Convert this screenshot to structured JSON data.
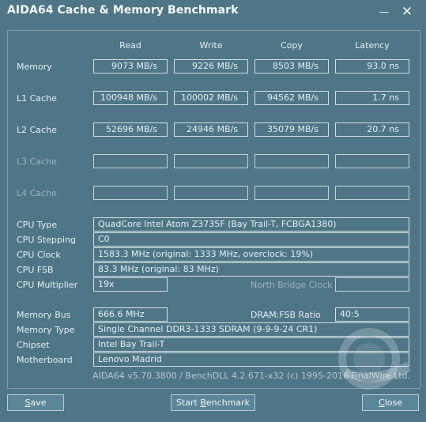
{
  "window": {
    "title": "AIDA64 Cache & Memory Benchmark",
    "minimize_glyph": "—",
    "close_glyph": "✕"
  },
  "columns": [
    "Read",
    "Write",
    "Copy",
    "Latency"
  ],
  "rows": [
    {
      "label": "Memory",
      "read": "9073 MB/s",
      "write": "9226 MB/s",
      "copy": "8503 MB/s",
      "latency": "93.0 ns",
      "enabled": true
    },
    {
      "label": "L1 Cache",
      "read": "100948 MB/s",
      "write": "100002 MB/s",
      "copy": "94562 MB/s",
      "latency": "1.7 ns",
      "enabled": true
    },
    {
      "label": "L2 Cache",
      "read": "52696 MB/s",
      "write": "24946 MB/s",
      "copy": "35079 MB/s",
      "latency": "20.7 ns",
      "enabled": true
    },
    {
      "label": "L3 Cache",
      "read": "",
      "write": "",
      "copy": "",
      "latency": "",
      "enabled": false
    },
    {
      "label": "L4 Cache",
      "read": "",
      "write": "",
      "copy": "",
      "latency": "",
      "enabled": false
    }
  ],
  "cpu": {
    "type_label": "CPU Type",
    "type": "QuadCore Intel Atom Z3735F  (Bay Trail-T, FCBGA1380)",
    "stepping_label": "CPU Stepping",
    "stepping": "C0",
    "clock_label": "CPU Clock",
    "clock": "1583.3 MHz  (original: 1333 MHz, overclock: 19%)",
    "fsb_label": "CPU FSB",
    "fsb": "83.3 MHz  (original: 83 MHz)",
    "multiplier_label": "CPU Multiplier",
    "multiplier": "19x",
    "nb_clock_label": "North Bridge Clock",
    "nb_clock": ""
  },
  "memory": {
    "bus_label": "Memory Bus",
    "bus": "666.6 MHz",
    "ratio_label": "DRAM:FSB Ratio",
    "ratio": "40:5",
    "type_label": "Memory Type",
    "type": "Single Channel DDR3-1333 SDRAM  (9-9-9-24 CR1)",
    "chipset_label": "Chipset",
    "chipset": "Intel Bay Trail-T",
    "motherboard_label": "Motherboard",
    "motherboard": "Lenovo Madrid"
  },
  "footer": "AIDA64 v5.70.3800 / BenchDLL 4.2.671-x32  (c) 1995-2016 FinalWire Ltd.",
  "buttons": {
    "save_prefix": "",
    "save_u": "S",
    "save_rest": "ave",
    "start_prefix": "Start ",
    "start_u": "B",
    "start_rest": "enchmark",
    "close_prefix": "",
    "close_u": "C",
    "close_rest": "lose"
  },
  "watermark": {
    "icon": "gecid-logo-watermark"
  }
}
